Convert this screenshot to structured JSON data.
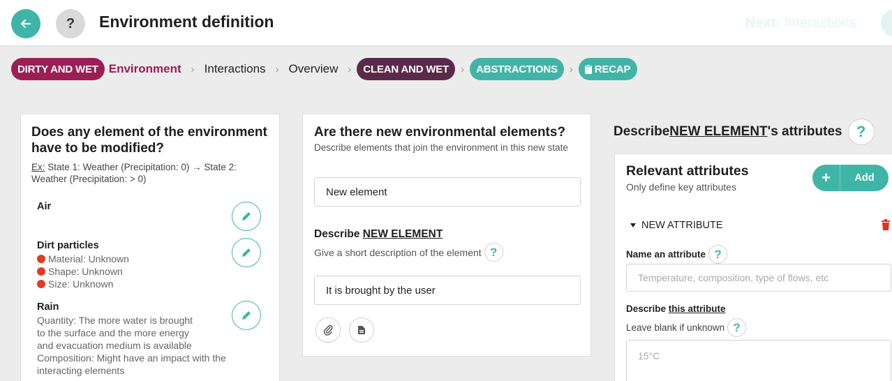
{
  "header": {
    "title": "Environment definition",
    "help_label": "?",
    "next_prefix": "Next:",
    "next_label": "Interactions"
  },
  "breadcrumb": {
    "state1": "DIRTY AND WET",
    "environment": "Environment",
    "interactions": "Interactions",
    "overview": "Overview",
    "state2": "CLEAN AND WET",
    "abstractions": "ABSTRACTIONS",
    "recap": "RECAP",
    "separator": "›"
  },
  "modify_panel": {
    "title": "Does any element of the environment have to be modified?",
    "example_prefix": "Ex:",
    "example_text": "State 1: Weather (Precipitation: 0) → State 2: Weather (Precipitation: > 0)",
    "elements": [
      {
        "name": "Air",
        "properties": [],
        "description": ""
      },
      {
        "name": "Dirt particles",
        "properties": [
          "Material: Unknown",
          "Shape: Unknown",
          "Size: Unknown"
        ],
        "description": ""
      },
      {
        "name": "Rain",
        "properties": [],
        "description_lines": [
          "Quantity: The more water is brought",
          "to the surface and the more energy",
          "and evacuation medium is available",
          "Composition: Might have an impact with the",
          "interacting elements"
        ]
      }
    ]
  },
  "new_elements_panel": {
    "title": "Are there new environmental elements?",
    "subtitle": "Describe elements that join the environment in this new state",
    "element_value": "New element",
    "describe_prefix": "Describe ",
    "describe_target": "NEW ELEMENT",
    "describe_hint": "Give a short description of the element",
    "description_value": "It is brought by the user"
  },
  "attributes_panel": {
    "heading_prefix": "Describe ",
    "heading_target": "NEW ELEMENT",
    "heading_suffix": "'s attributes",
    "card_title": "Relevant attributes",
    "card_subtitle": "Only define key attributes",
    "add_label": "Add",
    "attribute_header": "NEW ATTRIBUTE",
    "name_label": "Name an attribute",
    "name_placeholder": "Temperature, composition, type of flows, etc",
    "describe_prefix": "Describe ",
    "describe_target": "this attribute",
    "describe_hint": "Leave blank if unknown",
    "value_placeholder": "15°C"
  },
  "colors": {
    "teal": "#3fb5a8",
    "dirty": "#9b1e55",
    "clean": "#5a2a48",
    "unknown_dot": "#e03b24",
    "delete": "#e0341f"
  }
}
